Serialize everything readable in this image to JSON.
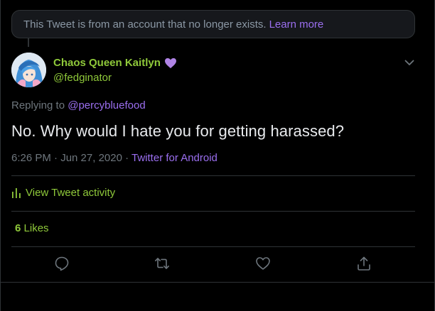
{
  "notice": {
    "text": "This Tweet is from an account that no longer exists.",
    "link": "Learn more"
  },
  "author": {
    "name": "Chaos Queen Kaitlyn",
    "handle": "@fedginator",
    "name_emoji": "purple-heart"
  },
  "reply": {
    "prefix": "Replying to",
    "mention": "@percybluefood"
  },
  "tweet": {
    "text": "No. Why would I hate you for getting harassed?",
    "time": "6:26 PM · Jun 27, 2020 ·",
    "source": "Twitter for Android"
  },
  "activity": {
    "label": "View Tweet activity"
  },
  "stats": {
    "likes_count": "6",
    "likes_label": "Likes"
  },
  "icons": {
    "reply": "reply-icon",
    "retweet": "retweet-icon",
    "like": "like-icon",
    "share": "share-icon",
    "caret": "chevron-down-icon",
    "activity": "bar-chart-icon"
  },
  "colors": {
    "background": "#000000",
    "accent_green": "#8fc93a",
    "link_purple": "#9b6ff0",
    "muted": "#6e767d",
    "border": "#2f3336"
  }
}
